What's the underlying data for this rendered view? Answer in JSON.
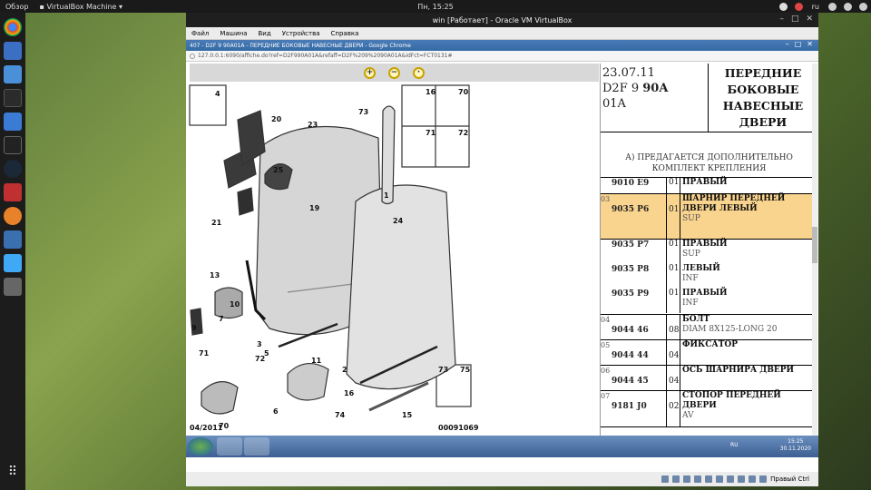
{
  "topbar": {
    "overview": "Обзор",
    "app": "VirtualBox Machine",
    "clock": "Пн, 15:25",
    "lang": "ru"
  },
  "window": {
    "title": "win [Работает] - Oracle VM VirtualBox",
    "menu": [
      "Файл",
      "Машина",
      "Вид",
      "Устройства",
      "Справка"
    ]
  },
  "browser": {
    "tab": "407 - D2F 9 90A01A - ПЕРЕДНИЕ БОКОВЫЕ НАВЕСНЫЕ ДВЕРИ - Google Chrome",
    "url": "127.0.0.1:6090/affiche.do?ref=D2F990A01A&refaff=D2F%209%2090A01A&idFct=FCT0131#"
  },
  "diagram": {
    "callouts": [
      "4",
      "20",
      "23",
      "73",
      "25",
      "21",
      "19",
      "24",
      "1",
      "13",
      "10",
      "9",
      "7",
      "71",
      "72",
      "11",
      "2",
      "3",
      "5",
      "70",
      "6",
      "74",
      "16",
      "15",
      "73",
      "75"
    ],
    "date_code": "04/2011",
    "ref_code": "00091069",
    "inset_labels": [
      "16",
      "70",
      "71",
      "72"
    ]
  },
  "header": {
    "date": "23.07.11",
    "code1": "D2F 9",
    "code1b": "90A",
    "code2": "01A",
    "title": "ПЕРЕДНИЕ БОКОВЫЕ НАВЕСНЫЕ ДВЕРИ"
  },
  "note": "А) ПРЕДАГАЕТСЯ ДОПОЛНИТЕЛЬНО КОМПЛЕКТ КРЕПЛЕНИЯ",
  "rows": [
    {
      "n": "",
      "code": "9010 E9",
      "qty": "01",
      "desc": "ПРАВЫЙ",
      "sub": ""
    },
    {
      "n": "03",
      "code": "9035 P6",
      "qty": "01",
      "desc": "ШАРНИР ПЕРЕДНЕЙ ДВЕРИ ЛЕВЫЙ",
      "sub": "SUP"
    },
    {
      "n": "",
      "code": "9035 P7",
      "qty": "01",
      "desc": "ПРАВЫЙ",
      "sub": "SUP"
    },
    {
      "n": "",
      "code": "9035 P8",
      "qty": "01",
      "desc": "ЛЕВЫЙ",
      "sub": "INF"
    },
    {
      "n": "",
      "code": "9035 P9",
      "qty": "01",
      "desc": "ПРАВЫЙ",
      "sub": "INF"
    },
    {
      "n": "04",
      "code": "9044 46",
      "qty": "08",
      "desc": "БОЛТ",
      "sub": "DIAM 8X125-LONG 20"
    },
    {
      "n": "05",
      "code": "9044 44",
      "qty": "04",
      "desc": "ФИКСАТОР",
      "sub": ""
    },
    {
      "n": "06",
      "code": "9044 45",
      "qty": "04",
      "desc": "ОСЬ ШАРНИРА ДВЕРИ",
      "sub": ""
    },
    {
      "n": "07",
      "code": "9181 J0",
      "qty": "02",
      "desc": "СТОПОР ПЕРЕДНЕЙ ДВЕРИ",
      "sub": "AV"
    }
  ],
  "taskbar": {
    "lang": "RU",
    "time": "15:25",
    "date": "30.11.2020"
  },
  "status": {
    "hostkey": "Правый Ctrl"
  }
}
